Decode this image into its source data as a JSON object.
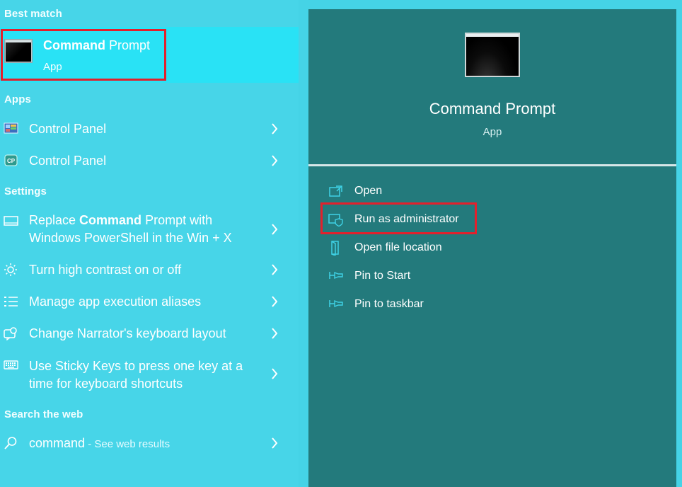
{
  "left": {
    "sections": {
      "best_match": "Best match",
      "apps": "Apps",
      "settings": "Settings",
      "search_web": "Search the web"
    },
    "best_match": {
      "title_bold": "Command",
      "title_rest": " Prompt",
      "subtitle": "App"
    },
    "apps": [
      {
        "label": "Control Panel",
        "icon": "control-panel-icon"
      },
      {
        "label": "Control Panel",
        "icon": "control-panel-cp-icon"
      }
    ],
    "settings": [
      {
        "line1_pre": "Replace ",
        "line1_bold": "Command",
        "line1_post": " Prompt with",
        "line2": "Windows PowerShell in the Win + X",
        "icon": "monitor-icon"
      },
      {
        "label": "Turn high contrast on or off",
        "icon": "brightness-icon"
      },
      {
        "label": "Manage app execution aliases",
        "icon": "list-icon"
      },
      {
        "label": "Change Narrator's keyboard layout",
        "icon": "narrator-icon"
      },
      {
        "line1": "Use Sticky Keys to press one key at a",
        "line2": "time for keyboard shortcuts",
        "icon": "keyboard-icon"
      }
    ],
    "web": {
      "query": "command",
      "suffix": " - See web results",
      "icon": "search-icon"
    }
  },
  "right": {
    "title": "Command Prompt",
    "subtitle": "App",
    "actions": [
      {
        "label": "Open",
        "icon": "open-icon"
      },
      {
        "label": "Run as administrator",
        "icon": "shield-icon"
      },
      {
        "label": "Open file location",
        "icon": "file-location-icon"
      },
      {
        "label": "Pin to Start",
        "icon": "pin-icon"
      },
      {
        "label": "Pin to taskbar",
        "icon": "pin-icon"
      }
    ]
  },
  "colors": {
    "left_bg": "#47d5e8",
    "best_match_bg": "#29e2f5",
    "right_bg": "#237a7c",
    "highlight": "#e3202c"
  }
}
